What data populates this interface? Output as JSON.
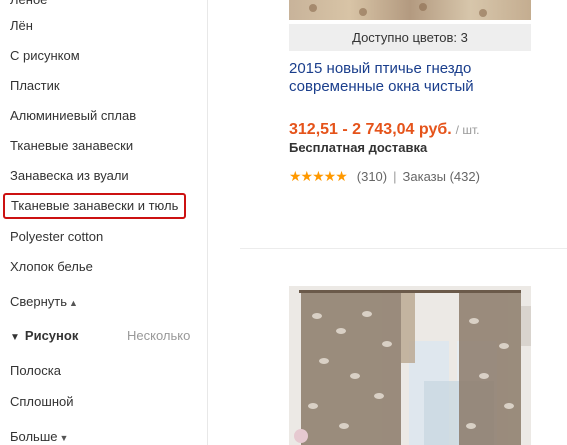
{
  "sidebar": {
    "partial_item": "Лёное",
    "items": [
      "Лён",
      "С рисунком",
      "Пластик",
      "Алюминиевый сплав",
      "Тканевые занавески",
      "Занавеска из вуали",
      "Тканевые занавески и тюль",
      "Polyester cotton",
      "Хлопок белье"
    ],
    "collapse_label": "Свернуть",
    "pattern_section": {
      "title": "Рисунок",
      "multi_label": "Несколько",
      "items": [
        "Полоска",
        "Сплошной"
      ]
    },
    "more_label": "Больше"
  },
  "product1": {
    "colors_available": "Доступно цветов: 3",
    "title": "2015 новый птичье гнездо современные окна чистый",
    "price": "312,51 - 2 743,04 руб.",
    "unit": "/ шт.",
    "shipping": "Бесплатная доставка",
    "rating_count": "(310)",
    "orders": "Заказы (432)"
  },
  "colors": {
    "accent_price": "#e5531a",
    "title_link": "#1a3e8c",
    "selected_border": "#cc1111",
    "star": "#ff9900"
  }
}
